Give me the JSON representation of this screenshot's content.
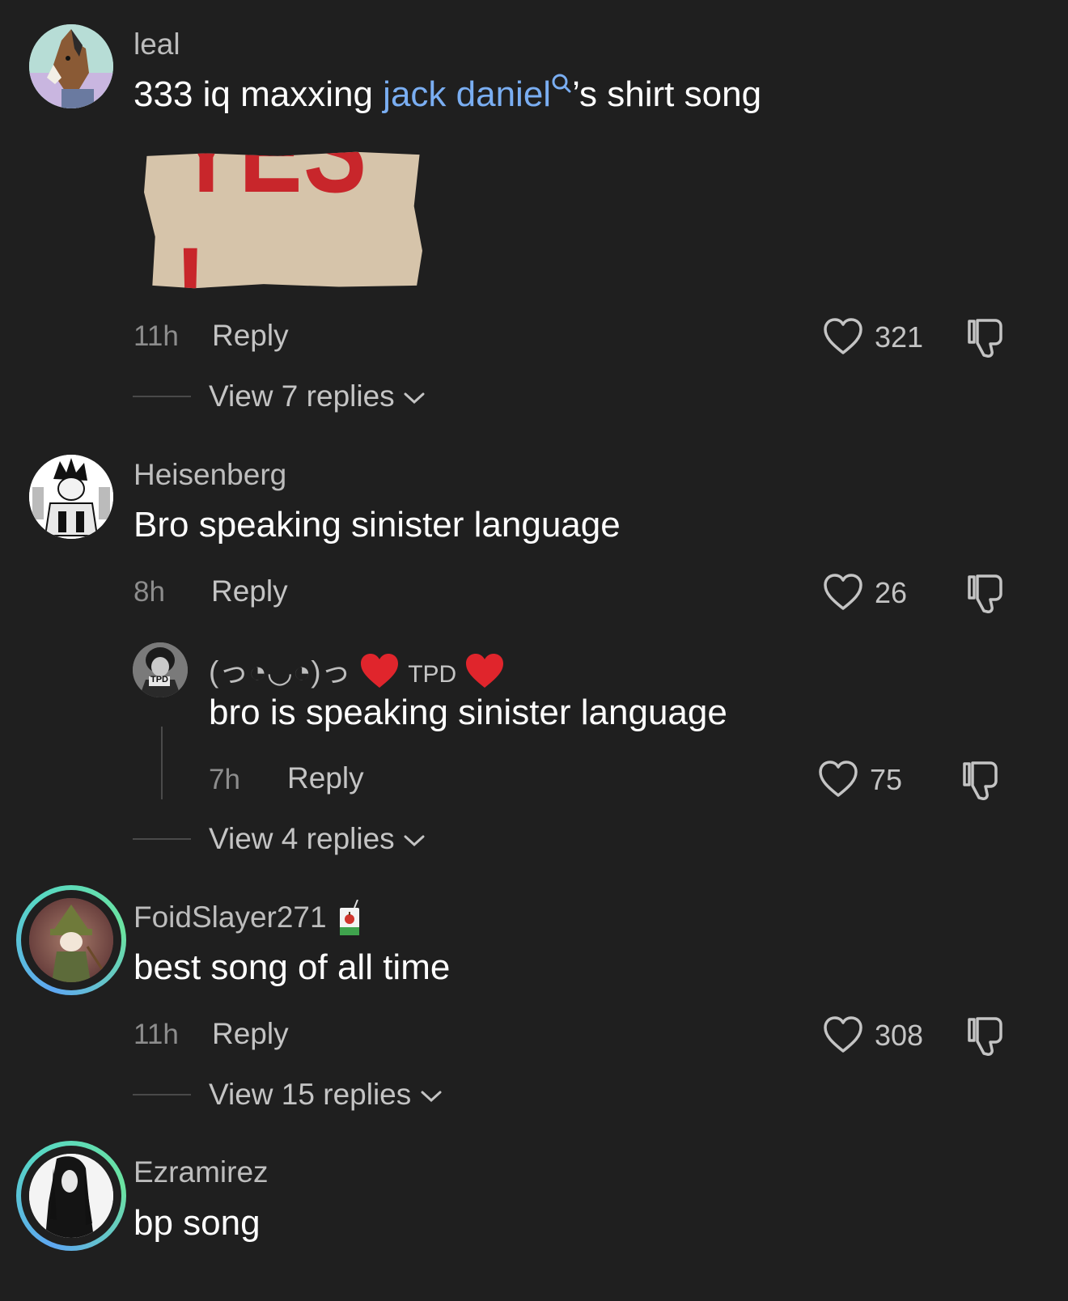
{
  "comments": [
    {
      "username": "leal",
      "text_before": "333 iq maxxing ",
      "mention": "jack daniel",
      "text_after": "’s shirt song",
      "sticker_text": "YES !",
      "time": "11h",
      "reply_label": "Reply",
      "likes": "321",
      "view_replies": "View 7 replies"
    },
    {
      "username": "Heisenberg",
      "text": "Bro speaking sinister language",
      "time": "8h",
      "reply_label": "Reply",
      "likes": "26",
      "view_replies": "View 4 replies",
      "reply": {
        "username_prefix": "(っ◔◡◔)っ",
        "username_tag": "TPD",
        "avatar_tag": "TPD",
        "text": "bro is speaking sinister language",
        "time": "7h",
        "reply_label": "Reply",
        "likes": "75"
      }
    },
    {
      "username": "FoidSlayer271",
      "text": "best song of all time",
      "time": "11h",
      "reply_label": "Reply",
      "likes": "308",
      "view_replies": "View 15 replies"
    },
    {
      "username": "Ezramirez",
      "text": "bp song"
    }
  ],
  "icons": {
    "like": "heart-outline-icon",
    "dislike": "thumbs-down-icon",
    "search": "search-icon",
    "chevron": "chevron-down-icon",
    "badge": "juice-box-icon"
  },
  "colors": {
    "background": "#1f1f1f",
    "mention": "#7aaef2",
    "heart_emoji": "#e0252c",
    "sticker_red": "#c8262b"
  }
}
